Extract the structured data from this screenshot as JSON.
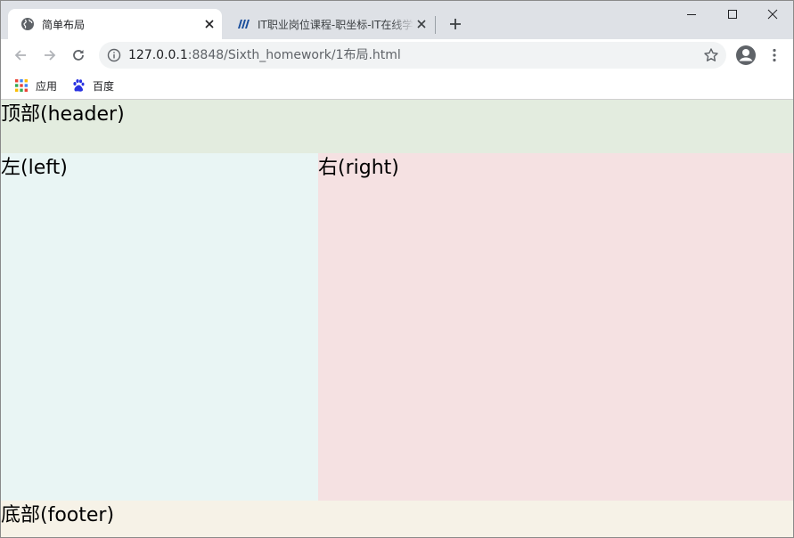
{
  "browser": {
    "tabs": [
      {
        "title": "简单布局",
        "active": true,
        "favicon": "globe-icon"
      },
      {
        "title": "IT职业岗位课程-职坐标-IT在线学",
        "active": false,
        "favicon": "zhizuobiao-logo-icon"
      }
    ],
    "url": {
      "host": "127.0.0.1",
      "path": ":8848/Sixth_homework/1布局.html"
    },
    "bookmarks": [
      {
        "label": "应用",
        "icon": "apps-grid-icon"
      },
      {
        "label": "百度",
        "icon": "baidu-paw-icon"
      }
    ]
  },
  "page": {
    "header": "顶部(header)",
    "left": "左(left)",
    "right": "右(right)",
    "footer": "底部(footer)"
  },
  "colors": {
    "header_bg": "#e3ecdf",
    "left_bg": "#e9f5f4",
    "right_bg": "#f5e1e2",
    "footer_bg": "#f6f2e7",
    "tabstrip_bg": "#dee1e6"
  }
}
